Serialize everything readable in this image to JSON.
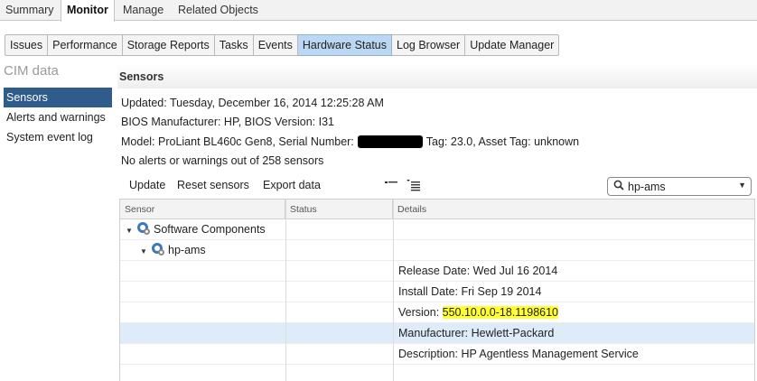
{
  "top_tabs": [
    "Summary",
    "Monitor",
    "Manage",
    "Related Objects"
  ],
  "sub_tabs": [
    "Issues",
    "Performance",
    "Storage Reports",
    "Tasks",
    "Events",
    "Hardware Status",
    "Log Browser",
    "Update Manager"
  ],
  "left_panel": {
    "title": "CIM data",
    "items": [
      "Sensors",
      "Alerts and warnings",
      "System event log"
    ]
  },
  "main": {
    "title": "Sensors",
    "info": {
      "updated": "Updated: Tuesday, December 16, 2014  12:25:28 AM",
      "bios": "BIOS Manufacturer:  HP,  BIOS Version:  I31",
      "model_prefix": "Model:  ProLiant BL460c Gen8,  Serial Number:",
      "model_suffix": "Tag:  23.0,   Asset Tag:  unknown",
      "alerts": "No alerts or warnings out of 258 sensors"
    },
    "actions": [
      "Update",
      "Reset sensors",
      "Export data"
    ],
    "filter_value": "hp-ams",
    "grid": {
      "columns": [
        "Sensor",
        "Status",
        "Details"
      ],
      "tree": {
        "root": "Software Components",
        "child": "hp-ams"
      },
      "details": {
        "release": "Release Date: Wed Jul 16 2014",
        "install": "Install Date: Fri Sep 19 2014",
        "version_label": "Version: ",
        "version_value": "550.10.0.0-18.1198610",
        "manufacturer": "Manufacturer: Hewlett-Packard",
        "description": "Description: HP Agentless Management Service"
      }
    }
  },
  "colors": {
    "selected_nav": "#2f5c8b",
    "active_subtab": "#bcd7f2",
    "selected_row": "#ddecf8",
    "highlight": "#ffff33"
  }
}
